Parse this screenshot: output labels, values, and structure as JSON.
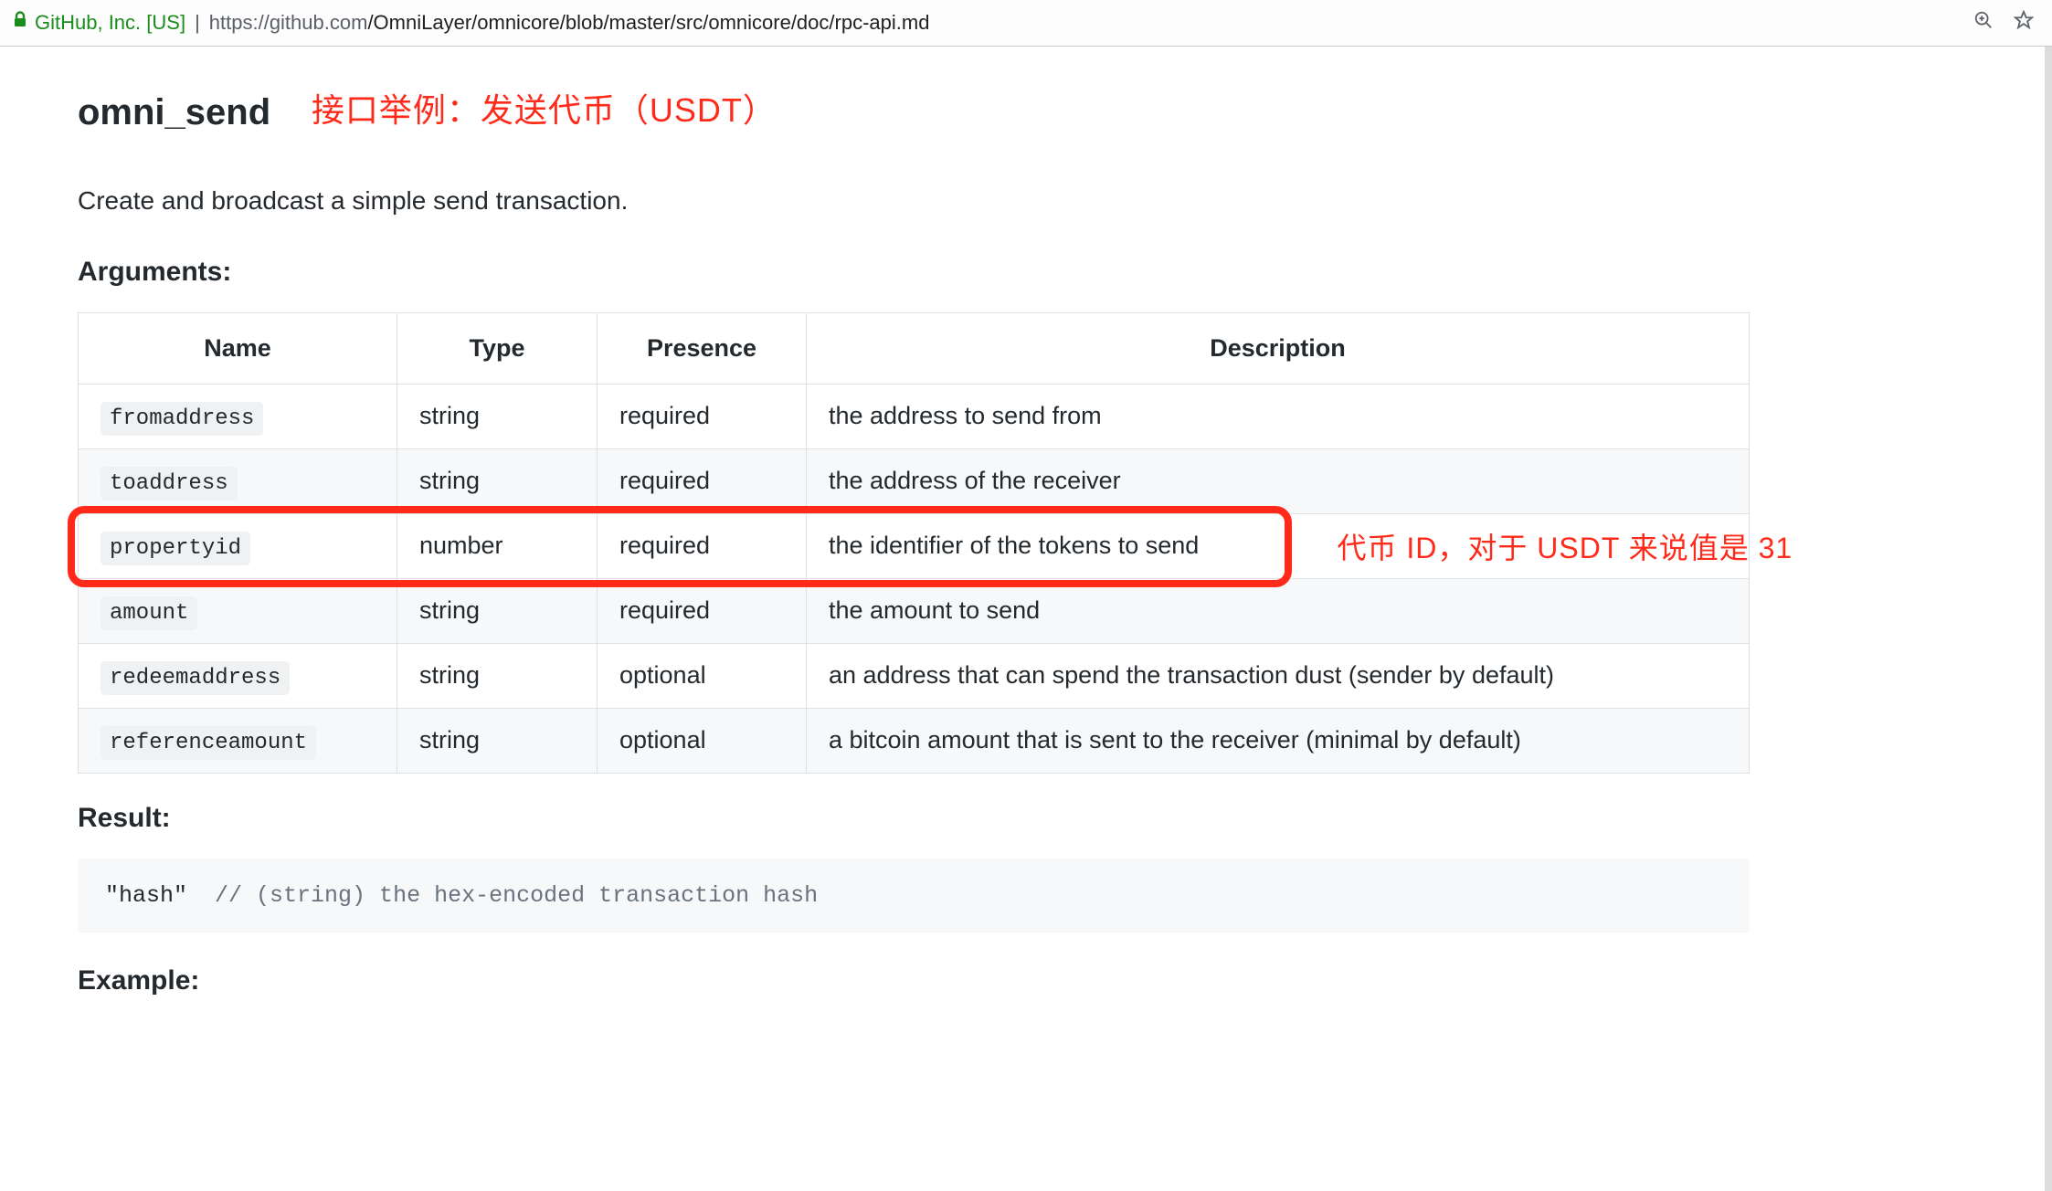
{
  "browser": {
    "cert_name": "GitHub, Inc. [US]",
    "url_host": "https://github.com",
    "url_path": "/OmniLayer/omnicore/blob/master/src/omnicore/doc/rpc-api.md"
  },
  "heading": {
    "api_name": "omni_send",
    "annotation": "接口举例：发送代币（USDT）"
  },
  "description": "Create and broadcast a simple send transaction.",
  "arguments_heading": "Arguments:",
  "table": {
    "headers": {
      "c0": "Name",
      "c1": "Type",
      "c2": "Presence",
      "c3": "Description"
    },
    "rows": [
      {
        "name": "fromaddress",
        "type": "string",
        "presence": "required",
        "desc": "the address to send from"
      },
      {
        "name": "toaddress",
        "type": "string",
        "presence": "required",
        "desc": "the address of the receiver"
      },
      {
        "name": "propertyid",
        "type": "number",
        "presence": "required",
        "desc": "the identifier of the tokens to send"
      },
      {
        "name": "amount",
        "type": "string",
        "presence": "required",
        "desc": "the amount to send"
      },
      {
        "name": "redeemaddress",
        "type": "string",
        "presence": "optional",
        "desc": "an address that can spend the transaction dust (sender by default)"
      },
      {
        "name": "referenceamount",
        "type": "string",
        "presence": "optional",
        "desc": "a bitcoin amount that is sent to the receiver (minimal by default)"
      }
    ],
    "row_annotation": "代币 ID，对于 USDT 来说值是 31"
  },
  "result_heading": "Result:",
  "result_code": {
    "value_part": "\"hash\"  ",
    "comment_part": "// (string) the hex-encoded transaction hash"
  },
  "example_heading": "Example:"
}
